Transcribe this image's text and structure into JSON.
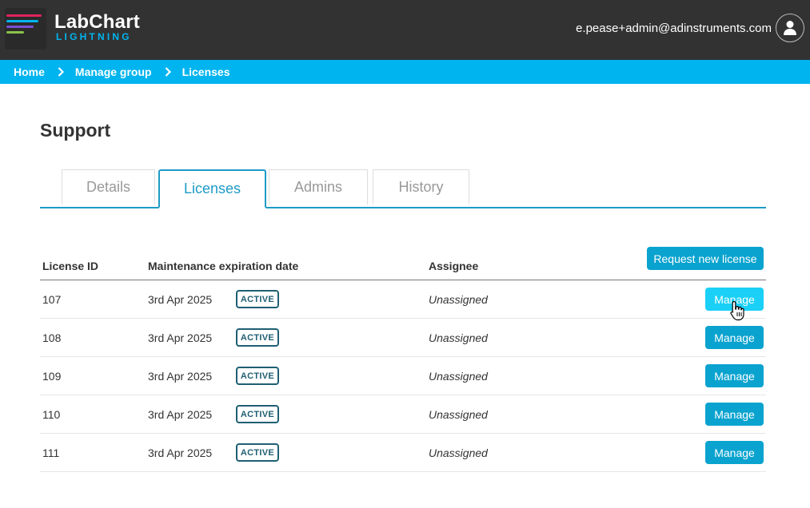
{
  "header": {
    "logo_main": "LabChart",
    "logo_sub": "LIGHTNING",
    "user_email": "e.pease+admin@adinstruments.com"
  },
  "breadcrumb": [
    "Home",
    "Manage group",
    "Licenses"
  ],
  "page": {
    "title": "Support"
  },
  "tabs": [
    {
      "label": "Details",
      "active": false
    },
    {
      "label": "Licenses",
      "active": true
    },
    {
      "label": "Admins",
      "active": false
    },
    {
      "label": "History",
      "active": false
    }
  ],
  "licenses": {
    "request_label": "Request new license",
    "columns": [
      "License ID",
      "Maintenance expiration date",
      "Assignee"
    ],
    "manage_label": "Manage",
    "rows": [
      {
        "id": "107",
        "expiry": "3rd Apr 2025",
        "status": "ACTIVE",
        "assignee": "Unassigned"
      },
      {
        "id": "108",
        "expiry": "3rd Apr 2025",
        "status": "ACTIVE",
        "assignee": "Unassigned"
      },
      {
        "id": "109",
        "expiry": "3rd Apr 2025",
        "status": "ACTIVE",
        "assignee": "Unassigned"
      },
      {
        "id": "110",
        "expiry": "3rd Apr 2025",
        "status": "ACTIVE",
        "assignee": "Unassigned"
      },
      {
        "id": "111",
        "expiry": "3rd Apr 2025",
        "status": "ACTIVE",
        "assignee": "Unassigned"
      }
    ]
  },
  "colors": {
    "header_bg": "#323232",
    "accent": "#00b4ef",
    "button": "#0aa3cf",
    "button_hover": "#1ad0f7",
    "tab_active": "#1d9bc6",
    "badge": "#1f5f73"
  }
}
